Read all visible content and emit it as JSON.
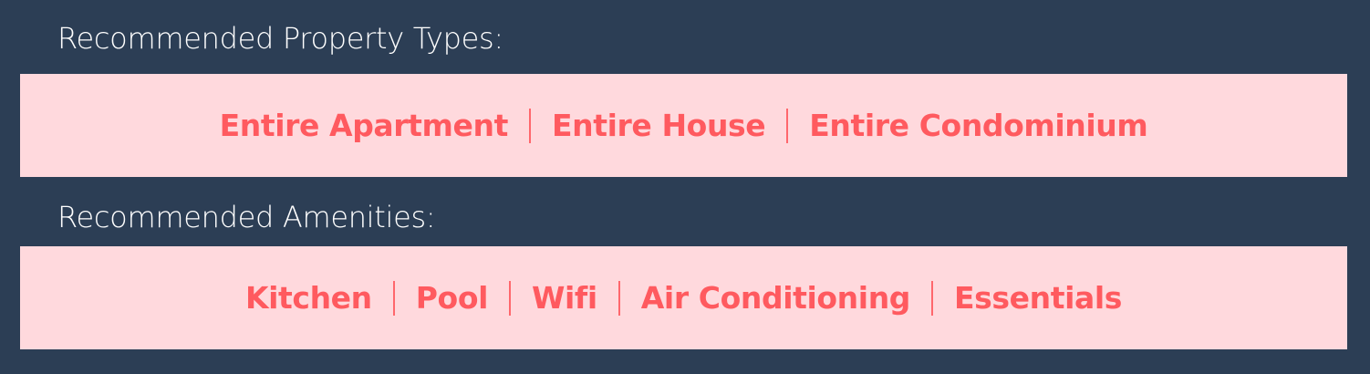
{
  "colors": {
    "background": "#2c3e55",
    "band": "#ffd9dd",
    "accent": "#ff5a5f",
    "label_text": "#ffffff"
  },
  "property_types": {
    "heading": "Recommended Property Types:",
    "items": [
      "Entire Apartment",
      "Entire House",
      "Entire Condominium"
    ]
  },
  "amenities": {
    "heading": "Recommended Amenities:",
    "items": [
      "Kitchen",
      "Pool",
      "Wifi",
      "Air Conditioning",
      "Essentials"
    ]
  }
}
